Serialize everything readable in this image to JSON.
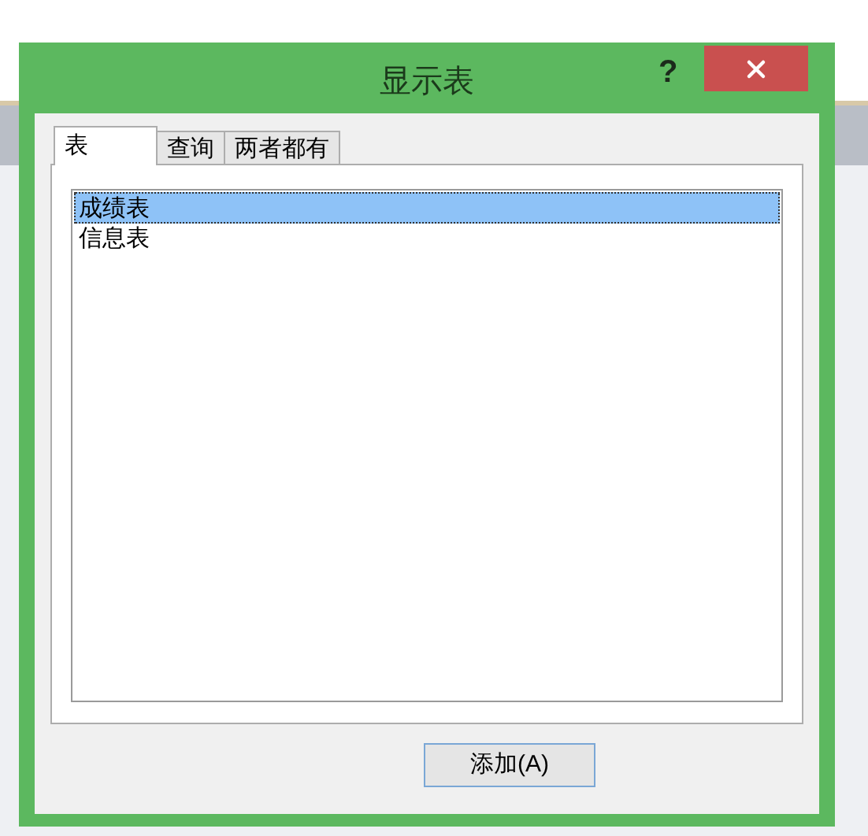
{
  "window": {
    "title": "显示表",
    "help": "?"
  },
  "tabs": [
    {
      "label": "表",
      "selected": true
    },
    {
      "label": "查询",
      "selected": false
    },
    {
      "label": "两者都有",
      "selected": false
    }
  ],
  "list": {
    "items": [
      {
        "label": "成绩表",
        "selected": true
      },
      {
        "label": "信息表",
        "selected": false
      }
    ]
  },
  "buttons": [
    "添加(A)"
  ]
}
